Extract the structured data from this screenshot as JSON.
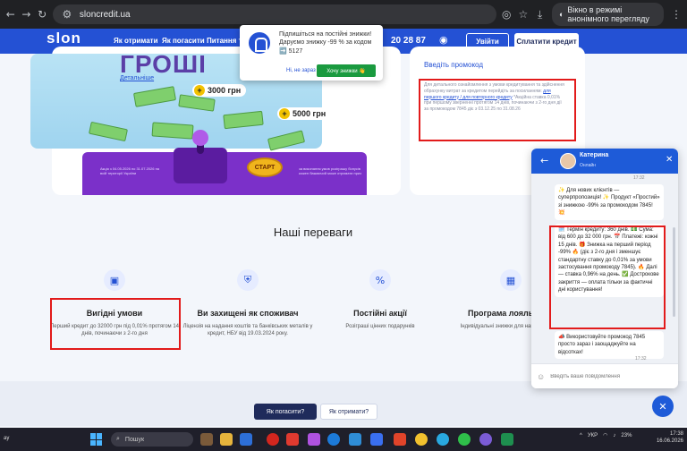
{
  "browser": {
    "url": "sloncredit.ua",
    "incognito_label": "Вікно в режимі анонімного перегляду"
  },
  "header": {
    "logo": "slon",
    "logo_sub": "CREDIT",
    "nav": [
      "Як отримати",
      "Як погасити",
      "Питання та"
    ],
    "phone": "20 28 87",
    "login_label": "Увійти",
    "pay_label": "Сплатити кредит"
  },
  "popup": {
    "text": "Підпишіться на постійні знижки! Даруємо знижку -99 % за кодом ➡️ 5127",
    "no_label": "Ні, не зараз",
    "yes_label": "Хочу знижки 👋"
  },
  "hero": {
    "title": "ГРОШІ",
    "details_link": "Детальніше",
    "bonus_1": "3000 грн",
    "bonus_2": "5000 грн",
    "start_label": "СТАРТ",
    "fine_left": "Акція з 04.05.2026 по 31.07.2026 на всій території України",
    "fine_right": "за виконання умов розіграшу бонусів кожен бажаючий може отримати приз"
  },
  "promo": {
    "label": "Введіть промокод",
    "info_1": "Для детального ознайомлення з умови кредитування та здійснення обрахунку витрат за кредитом перейдіть за посиланням:",
    "info_link": "для першого кредиту / для повторного кредиту",
    "info_2": "*Акційна ставка 0,01% при першому зверненні протягом 14 днів, починаючи з 2-го дня дії за промокодом 7845 діє з 03.12.25 по 31.08.26"
  },
  "advantages": {
    "title": "Наші переваги",
    "items": [
      {
        "icon": "money-icon",
        "head": "Вигідні умови",
        "text": "Перший кредит до 32000 грн під 0,01% протягом 14 днів, починаючи з 2-го дня"
      },
      {
        "icon": "shield-icon",
        "head": "Ви захищені як споживач",
        "text": "Ліцензія на надання коштів та банківських металів у кредит, НБУ від 19.03.2024 року."
      },
      {
        "icon": "percent-icon",
        "head": "Постійні акції",
        "text": "Розіграші цінних подарунків"
      },
      {
        "icon": "calendar-icon",
        "head": "Програма лояльності",
        "text": "Індивідуальні знижки для наших клієнтів"
      }
    ]
  },
  "bottom": {
    "pay_label": "Як погасити?",
    "get_label": "Як отримати?"
  },
  "chat": {
    "name": "Катерина",
    "status": "Онлайн",
    "time_1": "17:32",
    "msg_1": "✨ Для нових клієнтів — суперпропозиція! ✨ Продукт «Простий» зі знижкою -99% за промокодом 7845! 💥",
    "msg_2": "🗓️ Термін кредиту: 360 днів. 💵 Сума: від 600 до 32 000 грн. 📅 Платежі: кожні 15 днів. 🎁 Знижка на перший період -99% 🔥 (діє з 2-го дня і зменшує стандартну ставку до 0,01% за умови застосування промокоду 7845). 🔥 Далі — ставка 0,96% на день. ✅ Дострокове закриття — оплата тільки за фактичні дні користування!",
    "msg_3": "📣 Використовуйте промокод 7845 просто зараз і заощаджуйте на відсотках!",
    "time_2": "17:32",
    "input_placeholder": "Введіть ваше повідомлення"
  },
  "taskbar": {
    "left_text": "ay",
    "search": "Пошук",
    "lang": "УКР",
    "battery": "23%",
    "time": "17:38",
    "date": "16.06.2026"
  }
}
